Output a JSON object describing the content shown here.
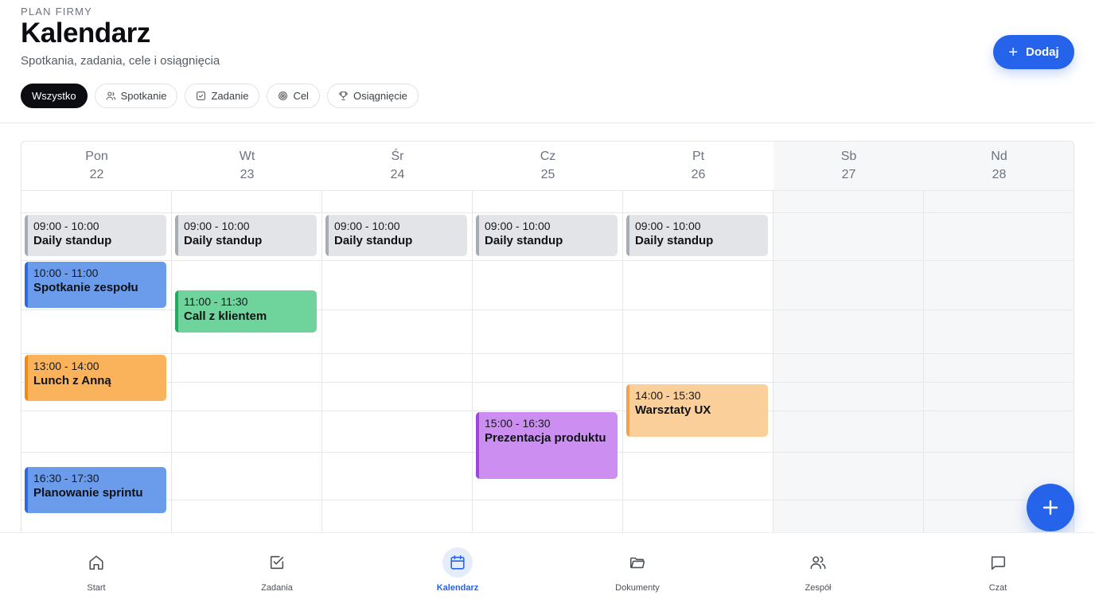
{
  "header": {
    "eyebrow": "PLAN FIRMY",
    "title": "Kalendarz",
    "subtitle": "Spotkania, zadania, cele i osiągnięcia",
    "add_label": "Dodaj"
  },
  "filters": [
    {
      "label": "Wszystko",
      "icon": "none",
      "active": true
    },
    {
      "label": "Spotkanie",
      "icon": "users-icon",
      "active": false
    },
    {
      "label": "Zadanie",
      "icon": "checkbox-icon",
      "active": false
    },
    {
      "label": "Cel",
      "icon": "target-icon",
      "active": false
    },
    {
      "label": "Osiągnięcie",
      "icon": "trophy-icon",
      "active": false
    }
  ],
  "days": [
    {
      "name": "Pon",
      "date": "22"
    },
    {
      "name": "Wt",
      "date": "23"
    },
    {
      "name": "Śr",
      "date": "24"
    },
    {
      "name": "Cz",
      "date": "25"
    },
    {
      "name": "Pt",
      "date": "26"
    },
    {
      "name": "Sb",
      "date": "27"
    },
    {
      "name": "Nd",
      "date": "28"
    }
  ],
  "events": [
    {
      "day": 0,
      "time": "09:00 - 10:00",
      "title": "Daily standup",
      "color": "gray"
    },
    {
      "day": 1,
      "time": "09:00 - 10:00",
      "title": "Daily standup",
      "color": "gray"
    },
    {
      "day": 2,
      "time": "09:00 - 10:00",
      "title": "Daily standup",
      "color": "gray"
    },
    {
      "day": 3,
      "time": "09:00 - 10:00",
      "title": "Daily standup",
      "color": "gray"
    },
    {
      "day": 4,
      "time": "09:00 - 10:00",
      "title": "Daily standup",
      "color": "gray"
    },
    {
      "day": 0,
      "time": "10:00 - 11:00",
      "title": "Spotkanie zespołu",
      "color": "blue"
    },
    {
      "day": 1,
      "time": "11:00 - 11:30",
      "title": "Call z klientem",
      "color": "green"
    },
    {
      "day": 0,
      "time": "13:00 - 14:00",
      "title": "Lunch z Anną",
      "color": "orange"
    },
    {
      "day": 4,
      "time": "14:00 - 15:30",
      "title": "Warsztaty UX",
      "color": "peach"
    },
    {
      "day": 3,
      "time": "15:00 - 16:30",
      "title": "Prezentacja produktu",
      "color": "purple"
    },
    {
      "day": 0,
      "time": "16:30 - 17:30",
      "title": "Planowanie sprintu",
      "color": "blue"
    }
  ],
  "nav": [
    {
      "label": "Start",
      "icon": "home-icon",
      "active": false
    },
    {
      "label": "Zadania",
      "icon": "checkbox-icon",
      "active": false
    },
    {
      "label": "Kalendarz",
      "icon": "calendar-icon",
      "active": true
    },
    {
      "label": "Dokumenty",
      "icon": "folder-icon",
      "active": false
    },
    {
      "label": "Zespół",
      "icon": "users-icon",
      "active": false
    },
    {
      "label": "Czat",
      "icon": "chat-icon",
      "active": false
    }
  ],
  "colors": {
    "accent": "#2563eb",
    "active_chip": "#0b0d12"
  }
}
